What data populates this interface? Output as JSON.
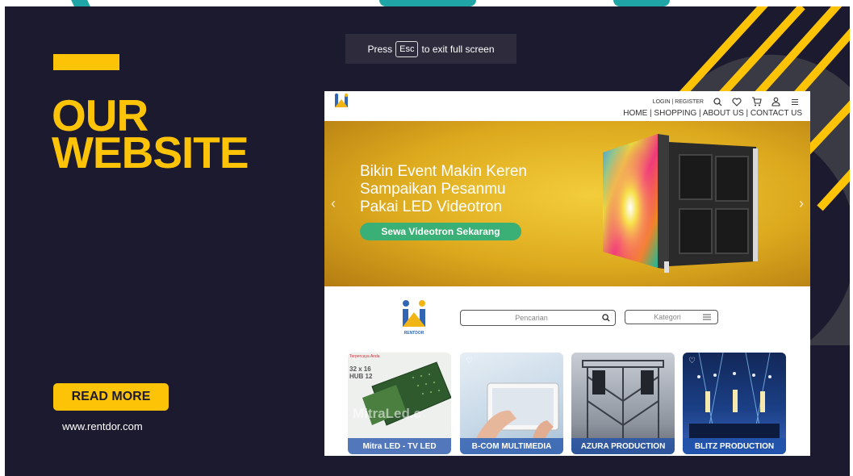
{
  "fullscreen_notice": {
    "before": "Press",
    "key": "Esc",
    "after": "to exit full screen"
  },
  "slide": {
    "title_line1": "OUR",
    "title_line2": "WEBSITE",
    "button_label": "READ MORE",
    "url": "www.rentdor.com",
    "colors": {
      "background": "#1c1a2e",
      "accent": "#fcc307"
    }
  },
  "site": {
    "header": {
      "auth_links": "LOGIN | REGISTER",
      "nav": "HOME | SHOPPING | ABOUT US | CONTACT US",
      "icons": [
        "search-icon",
        "heart-icon",
        "cart-icon",
        "user-icon",
        "menu-icon"
      ]
    },
    "hero": {
      "line1": "Bikin Event Makin Keren",
      "line2": "Sampaikan Pesanmu",
      "line3": "Pakai LED Videotron",
      "cta": "Sewa Videotron Sekarang"
    },
    "logo_text": "RENTDOR",
    "search": {
      "placeholder": "Pencarian",
      "category": "Kategori"
    },
    "cards": [
      {
        "label": "Mitra LED - TV LED",
        "tag": "Terpercaya Anda",
        "spec_line1": "32 x 16",
        "spec_line2": "HUB 12",
        "watermark": "MitraLed.c"
      },
      {
        "label": "B-COM MULTIMEDIA"
      },
      {
        "label": "AZURA PRODUCTION"
      },
      {
        "label": "BLITZ PRODUCTION"
      }
    ]
  }
}
